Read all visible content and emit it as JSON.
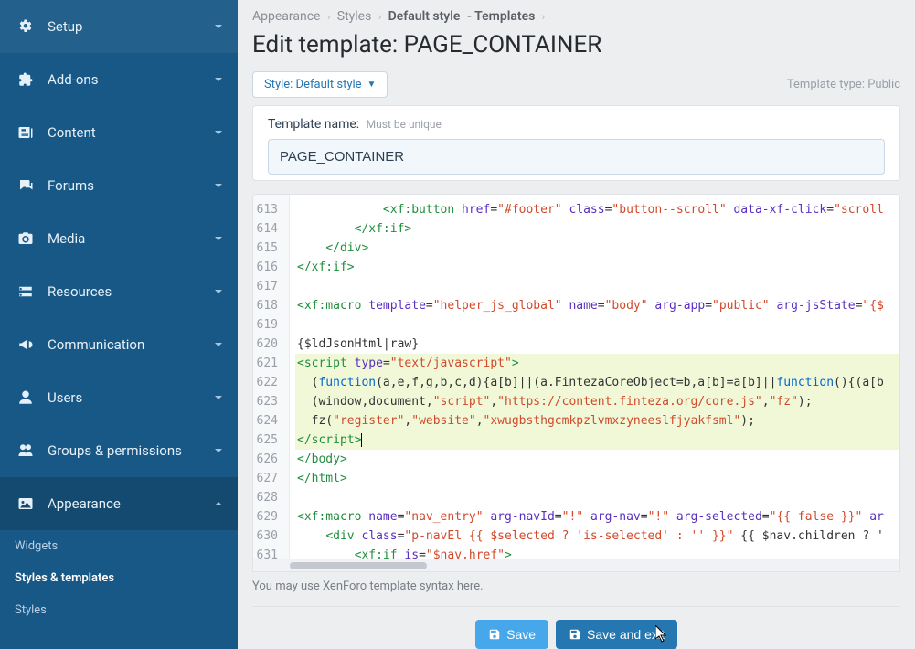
{
  "sidebar": {
    "items": [
      {
        "label": "Setup",
        "icon": "gear"
      },
      {
        "label": "Add-ons",
        "icon": "puzzle"
      },
      {
        "label": "Content",
        "icon": "newspaper"
      },
      {
        "label": "Forums",
        "icon": "comments"
      },
      {
        "label": "Media",
        "icon": "camera"
      },
      {
        "label": "Resources",
        "icon": "drive"
      },
      {
        "label": "Communication",
        "icon": "bullhorn"
      },
      {
        "label": "Users",
        "icon": "user"
      },
      {
        "label": "Groups & permissions",
        "icon": "users"
      },
      {
        "label": "Appearance",
        "icon": "image",
        "expanded": true
      }
    ],
    "subitems": [
      {
        "label": "Widgets",
        "active": false
      },
      {
        "label": "Styles & templates",
        "active": true
      },
      {
        "label": "Styles",
        "active": false
      }
    ]
  },
  "breadcrumbs": {
    "items": [
      "Appearance",
      "Styles",
      "Default style"
    ],
    "suffix": "- Templates"
  },
  "page_title": "Edit template: PAGE_CONTAINER",
  "style_dropdown": "Style: Default style",
  "template_type": "Template type: Public",
  "template_name": {
    "label": "Template name:",
    "hint": "Must be unique",
    "value": "PAGE_CONTAINER"
  },
  "editor": {
    "first_line_no": 613,
    "lines": [
      {
        "hl": false,
        "parts": [
          {
            "t": "txt",
            "v": "            "
          },
          {
            "t": "tag",
            "v": "<xf:button"
          },
          {
            "t": "txt",
            "v": " "
          },
          {
            "t": "attr",
            "v": "href"
          },
          {
            "t": "txt",
            "v": "="
          },
          {
            "t": "str",
            "v": "\"#footer\""
          },
          {
            "t": "txt",
            "v": " "
          },
          {
            "t": "attr",
            "v": "class"
          },
          {
            "t": "txt",
            "v": "="
          },
          {
            "t": "str",
            "v": "\"button--scroll\""
          },
          {
            "t": "txt",
            "v": " "
          },
          {
            "t": "attr",
            "v": "data-xf-click"
          },
          {
            "t": "txt",
            "v": "="
          },
          {
            "t": "str",
            "v": "\"scroll"
          }
        ]
      },
      {
        "hl": false,
        "parts": [
          {
            "t": "txt",
            "v": "        "
          },
          {
            "t": "tag",
            "v": "</xf:if>"
          }
        ]
      },
      {
        "hl": false,
        "parts": [
          {
            "t": "txt",
            "v": "    "
          },
          {
            "t": "tag",
            "v": "</div>"
          }
        ]
      },
      {
        "hl": false,
        "parts": [
          {
            "t": "tag",
            "v": "</xf:if>"
          }
        ]
      },
      {
        "hl": false,
        "parts": []
      },
      {
        "hl": false,
        "parts": [
          {
            "t": "tag",
            "v": "<xf:macro"
          },
          {
            "t": "txt",
            "v": " "
          },
          {
            "t": "attr",
            "v": "template"
          },
          {
            "t": "txt",
            "v": "="
          },
          {
            "t": "str",
            "v": "\"helper_js_global\""
          },
          {
            "t": "txt",
            "v": " "
          },
          {
            "t": "attr",
            "v": "name"
          },
          {
            "t": "txt",
            "v": "="
          },
          {
            "t": "str",
            "v": "\"body\""
          },
          {
            "t": "txt",
            "v": " "
          },
          {
            "t": "attr",
            "v": "arg-app"
          },
          {
            "t": "txt",
            "v": "="
          },
          {
            "t": "str",
            "v": "\"public\""
          },
          {
            "t": "txt",
            "v": " "
          },
          {
            "t": "attr",
            "v": "arg-jsState"
          },
          {
            "t": "txt",
            "v": "="
          },
          {
            "t": "str",
            "v": "\"{$"
          }
        ]
      },
      {
        "hl": false,
        "parts": []
      },
      {
        "hl": false,
        "parts": [
          {
            "t": "txt",
            "v": "{$ldJsonHtml|raw}"
          }
        ]
      },
      {
        "hl": true,
        "parts": [
          {
            "t": "tag",
            "v": "<script"
          },
          {
            "t": "txt",
            "v": " "
          },
          {
            "t": "attr",
            "v": "type"
          },
          {
            "t": "txt",
            "v": "="
          },
          {
            "t": "str",
            "v": "\"text/javascript\""
          },
          {
            "t": "tag",
            "v": ">"
          }
        ]
      },
      {
        "hl": true,
        "parts": [
          {
            "t": "txt",
            "v": "  ("
          },
          {
            "t": "kw",
            "v": "function"
          },
          {
            "t": "txt",
            "v": "(a,e,f,g,b,c,d){a[b]||(a.FintezaCoreObject=b,a[b]=a[b]||"
          },
          {
            "t": "kw",
            "v": "function"
          },
          {
            "t": "txt",
            "v": "(){(a[b"
          }
        ]
      },
      {
        "hl": true,
        "parts": [
          {
            "t": "txt",
            "v": "  (window,document,"
          },
          {
            "t": "str",
            "v": "\"script\""
          },
          {
            "t": "txt",
            "v": ","
          },
          {
            "t": "str",
            "v": "\"https://content.finteza.org/core.js\""
          },
          {
            "t": "txt",
            "v": ","
          },
          {
            "t": "str",
            "v": "\"fz\""
          },
          {
            "t": "txt",
            "v": ");"
          }
        ]
      },
      {
        "hl": true,
        "parts": [
          {
            "t": "txt",
            "v": "  fz("
          },
          {
            "t": "str",
            "v": "\"register\""
          },
          {
            "t": "txt",
            "v": ","
          },
          {
            "t": "str",
            "v": "\"website\""
          },
          {
            "t": "txt",
            "v": ","
          },
          {
            "t": "str",
            "v": "\"xwugbsthgcmkpzlvmxzyneeslfjyakfsml\""
          },
          {
            "t": "txt",
            "v": ");"
          }
        ]
      },
      {
        "hl": true,
        "parts": [
          {
            "t": "tag",
            "v": "</script>"
          },
          {
            "t": "cursor",
            "v": ""
          }
        ]
      },
      {
        "hl": false,
        "parts": [
          {
            "t": "tag",
            "v": "</body>"
          }
        ]
      },
      {
        "hl": false,
        "parts": [
          {
            "t": "tag",
            "v": "</html>"
          }
        ]
      },
      {
        "hl": false,
        "parts": []
      },
      {
        "hl": false,
        "parts": [
          {
            "t": "tag",
            "v": "<xf:macro"
          },
          {
            "t": "txt",
            "v": " "
          },
          {
            "t": "attr",
            "v": "name"
          },
          {
            "t": "txt",
            "v": "="
          },
          {
            "t": "str",
            "v": "\"nav_entry\""
          },
          {
            "t": "txt",
            "v": " "
          },
          {
            "t": "attr",
            "v": "arg-navId"
          },
          {
            "t": "txt",
            "v": "="
          },
          {
            "t": "str",
            "v": "\"!\""
          },
          {
            "t": "txt",
            "v": " "
          },
          {
            "t": "attr",
            "v": "arg-nav"
          },
          {
            "t": "txt",
            "v": "="
          },
          {
            "t": "str",
            "v": "\"!\""
          },
          {
            "t": "txt",
            "v": " "
          },
          {
            "t": "attr",
            "v": "arg-selected"
          },
          {
            "t": "txt",
            "v": "="
          },
          {
            "t": "str",
            "v": "\"{{ false }}\""
          },
          {
            "t": "txt",
            "v": " "
          },
          {
            "t": "attr",
            "v": "ar"
          }
        ]
      },
      {
        "hl": false,
        "parts": [
          {
            "t": "txt",
            "v": "    "
          },
          {
            "t": "tag",
            "v": "<div"
          },
          {
            "t": "txt",
            "v": " "
          },
          {
            "t": "attr",
            "v": "class"
          },
          {
            "t": "txt",
            "v": "="
          },
          {
            "t": "str",
            "v": "\"p-navEl {{ $selected ? 'is-selected' : '' }}\""
          },
          {
            "t": "txt",
            "v": " {{ $nav.children ? '"
          }
        ]
      },
      {
        "hl": false,
        "parts": [
          {
            "t": "txt",
            "v": "        "
          },
          {
            "t": "tag",
            "v": "<xf:if"
          },
          {
            "t": "txt",
            "v": " "
          },
          {
            "t": "attr",
            "v": "is"
          },
          {
            "t": "txt",
            "v": "="
          },
          {
            "t": "str",
            "v": "\"$nav.href\""
          },
          {
            "t": "tag",
            "v": ">"
          }
        ]
      }
    ],
    "help_text": "You may use XenForo template syntax here."
  },
  "buttons": {
    "save": "Save",
    "save_exit": "Save and exit"
  }
}
